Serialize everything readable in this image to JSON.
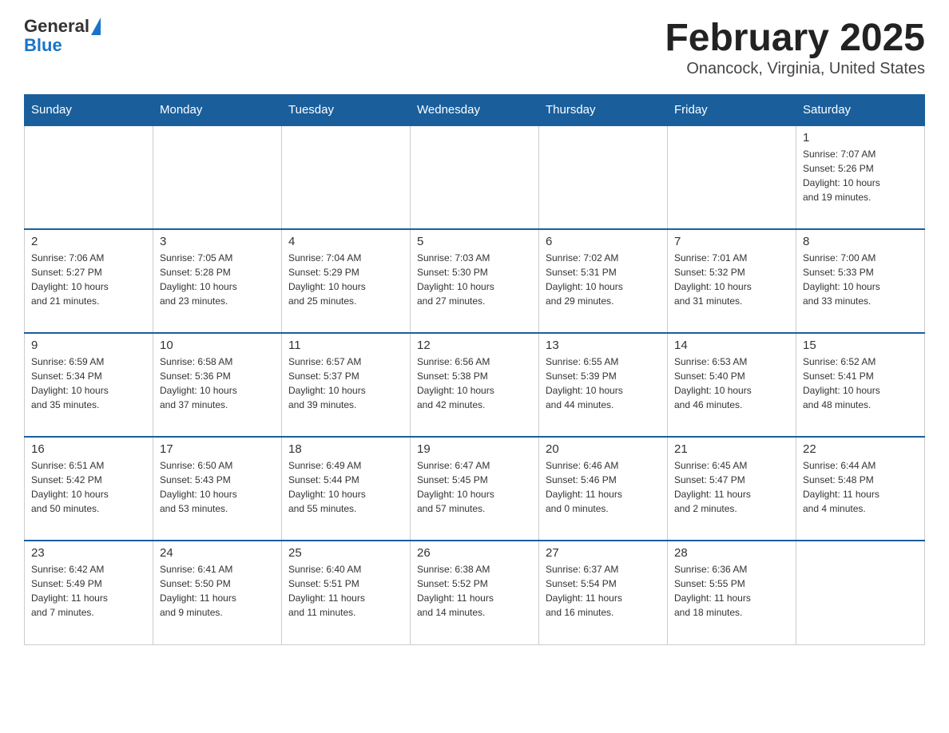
{
  "header": {
    "logo_general": "General",
    "logo_blue": "Blue",
    "title": "February 2025",
    "location": "Onancock, Virginia, United States"
  },
  "weekdays": [
    "Sunday",
    "Monday",
    "Tuesday",
    "Wednesday",
    "Thursday",
    "Friday",
    "Saturday"
  ],
  "weeks": [
    [
      {
        "day": "",
        "info": ""
      },
      {
        "day": "",
        "info": ""
      },
      {
        "day": "",
        "info": ""
      },
      {
        "day": "",
        "info": ""
      },
      {
        "day": "",
        "info": ""
      },
      {
        "day": "",
        "info": ""
      },
      {
        "day": "1",
        "info": "Sunrise: 7:07 AM\nSunset: 5:26 PM\nDaylight: 10 hours\nand 19 minutes."
      }
    ],
    [
      {
        "day": "2",
        "info": "Sunrise: 7:06 AM\nSunset: 5:27 PM\nDaylight: 10 hours\nand 21 minutes."
      },
      {
        "day": "3",
        "info": "Sunrise: 7:05 AM\nSunset: 5:28 PM\nDaylight: 10 hours\nand 23 minutes."
      },
      {
        "day": "4",
        "info": "Sunrise: 7:04 AM\nSunset: 5:29 PM\nDaylight: 10 hours\nand 25 minutes."
      },
      {
        "day": "5",
        "info": "Sunrise: 7:03 AM\nSunset: 5:30 PM\nDaylight: 10 hours\nand 27 minutes."
      },
      {
        "day": "6",
        "info": "Sunrise: 7:02 AM\nSunset: 5:31 PM\nDaylight: 10 hours\nand 29 minutes."
      },
      {
        "day": "7",
        "info": "Sunrise: 7:01 AM\nSunset: 5:32 PM\nDaylight: 10 hours\nand 31 minutes."
      },
      {
        "day": "8",
        "info": "Sunrise: 7:00 AM\nSunset: 5:33 PM\nDaylight: 10 hours\nand 33 minutes."
      }
    ],
    [
      {
        "day": "9",
        "info": "Sunrise: 6:59 AM\nSunset: 5:34 PM\nDaylight: 10 hours\nand 35 minutes."
      },
      {
        "day": "10",
        "info": "Sunrise: 6:58 AM\nSunset: 5:36 PM\nDaylight: 10 hours\nand 37 minutes."
      },
      {
        "day": "11",
        "info": "Sunrise: 6:57 AM\nSunset: 5:37 PM\nDaylight: 10 hours\nand 39 minutes."
      },
      {
        "day": "12",
        "info": "Sunrise: 6:56 AM\nSunset: 5:38 PM\nDaylight: 10 hours\nand 42 minutes."
      },
      {
        "day": "13",
        "info": "Sunrise: 6:55 AM\nSunset: 5:39 PM\nDaylight: 10 hours\nand 44 minutes."
      },
      {
        "day": "14",
        "info": "Sunrise: 6:53 AM\nSunset: 5:40 PM\nDaylight: 10 hours\nand 46 minutes."
      },
      {
        "day": "15",
        "info": "Sunrise: 6:52 AM\nSunset: 5:41 PM\nDaylight: 10 hours\nand 48 minutes."
      }
    ],
    [
      {
        "day": "16",
        "info": "Sunrise: 6:51 AM\nSunset: 5:42 PM\nDaylight: 10 hours\nand 50 minutes."
      },
      {
        "day": "17",
        "info": "Sunrise: 6:50 AM\nSunset: 5:43 PM\nDaylight: 10 hours\nand 53 minutes."
      },
      {
        "day": "18",
        "info": "Sunrise: 6:49 AM\nSunset: 5:44 PM\nDaylight: 10 hours\nand 55 minutes."
      },
      {
        "day": "19",
        "info": "Sunrise: 6:47 AM\nSunset: 5:45 PM\nDaylight: 10 hours\nand 57 minutes."
      },
      {
        "day": "20",
        "info": "Sunrise: 6:46 AM\nSunset: 5:46 PM\nDaylight: 11 hours\nand 0 minutes."
      },
      {
        "day": "21",
        "info": "Sunrise: 6:45 AM\nSunset: 5:47 PM\nDaylight: 11 hours\nand 2 minutes."
      },
      {
        "day": "22",
        "info": "Sunrise: 6:44 AM\nSunset: 5:48 PM\nDaylight: 11 hours\nand 4 minutes."
      }
    ],
    [
      {
        "day": "23",
        "info": "Sunrise: 6:42 AM\nSunset: 5:49 PM\nDaylight: 11 hours\nand 7 minutes."
      },
      {
        "day": "24",
        "info": "Sunrise: 6:41 AM\nSunset: 5:50 PM\nDaylight: 11 hours\nand 9 minutes."
      },
      {
        "day": "25",
        "info": "Sunrise: 6:40 AM\nSunset: 5:51 PM\nDaylight: 11 hours\nand 11 minutes."
      },
      {
        "day": "26",
        "info": "Sunrise: 6:38 AM\nSunset: 5:52 PM\nDaylight: 11 hours\nand 14 minutes."
      },
      {
        "day": "27",
        "info": "Sunrise: 6:37 AM\nSunset: 5:54 PM\nDaylight: 11 hours\nand 16 minutes."
      },
      {
        "day": "28",
        "info": "Sunrise: 6:36 AM\nSunset: 5:55 PM\nDaylight: 11 hours\nand 18 minutes."
      },
      {
        "day": "",
        "info": ""
      }
    ]
  ]
}
